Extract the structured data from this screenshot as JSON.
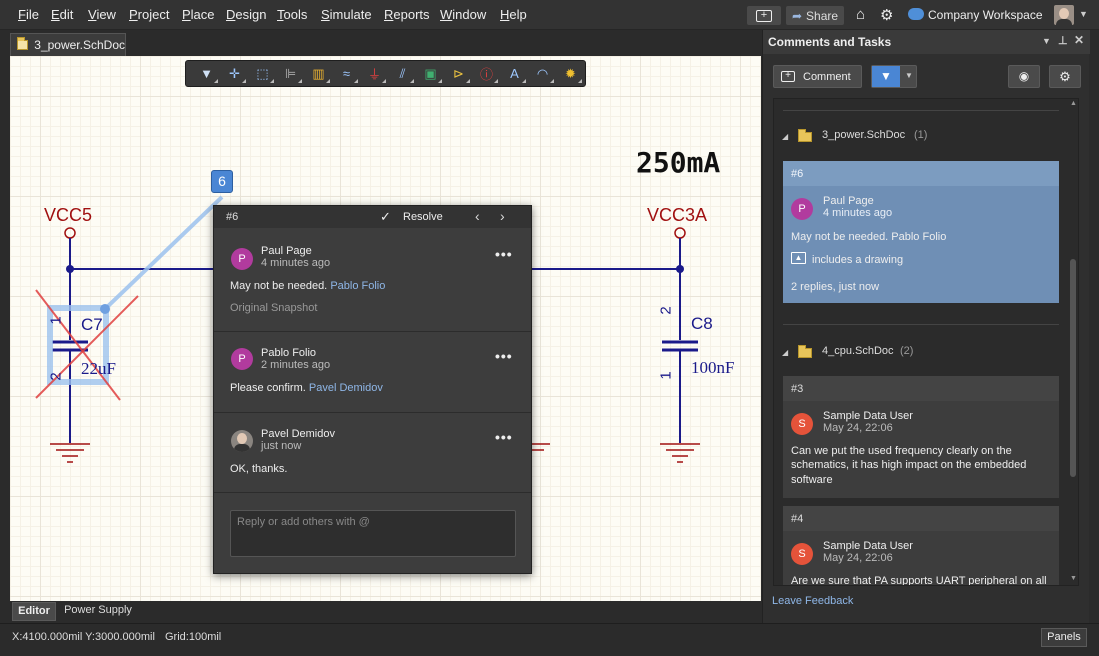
{
  "menu": [
    "File",
    "Edit",
    "View",
    "Project",
    "Place",
    "Design",
    "Tools",
    "Simulate",
    "Reports",
    "Window",
    "Help"
  ],
  "topbar": {
    "share_label": "Share",
    "workspace_label": "Company Workspace"
  },
  "document_tab": {
    "label": "3_power.SchDoc"
  },
  "schematic": {
    "current_note": "250mA",
    "net_left": "VCC5",
    "net_right": "VCC3A",
    "c7_designator": "C7",
    "c7_value": "22uF",
    "c8_designator": "C8",
    "c8_value": "100nF",
    "pin_1": "1",
    "pin_2": "2",
    "comment_marker": "6"
  },
  "popup": {
    "id": "#6",
    "resolve_label": "Resolve",
    "entries": [
      {
        "initial": "P",
        "name": "Paul Page",
        "time": "4 minutes ago",
        "text": "May not be needed.",
        "mention": "Pablo Folio",
        "extra": "Original Snapshot"
      },
      {
        "initial": "P",
        "name": "Pablo Folio",
        "time": "2 minutes ago",
        "text": "Please confirm.",
        "mention": "Pavel Demidov"
      },
      {
        "name": "Pavel Demidov",
        "time": "just now",
        "text": "OK, thanks."
      }
    ],
    "reply_placeholder": "Reply or add others with @"
  },
  "panel": {
    "title": "Comments and Tasks",
    "comment_button": "Comment",
    "feedback_link": "Leave Feedback",
    "groups": [
      {
        "file": "3_power.SchDoc",
        "count": "(1)"
      },
      {
        "file": "4_cpu.SchDoc",
        "count": "(2)"
      }
    ],
    "cards": [
      {
        "id": "#6",
        "initial": "P",
        "author": "Paul Page",
        "time": "4 minutes ago",
        "text": "May not be needed. Pablo Folio",
        "attachment": "includes a drawing",
        "replies": "2 replies, just now"
      },
      {
        "id": "#3",
        "initial": "S",
        "author": "Sample Data User",
        "time": "May 24, 22:06",
        "text_lines": [
          "Can we put the used frequency clearly on the",
          "schematics, it has high impact on the embedded",
          "software"
        ]
      },
      {
        "id": "#4",
        "initial": "S",
        "author": "Sample Data User",
        "time": "May 24, 22:06",
        "text": "Are we sure that PA supports UART peripheral on all"
      }
    ]
  },
  "bottom_tabs": [
    "Editor",
    "Power Supply"
  ],
  "status": {
    "coords": "X:4100.000mil Y:3000.000mil",
    "grid": "Grid:100mil",
    "panels_button": "Panels"
  },
  "colors": {
    "avatar_purple": "#b13b9e",
    "avatar_red": "#e5533a",
    "selection_blue": "#6f8fb5",
    "net_red": "#a01010",
    "wire_blue": "#1a1a8a"
  }
}
